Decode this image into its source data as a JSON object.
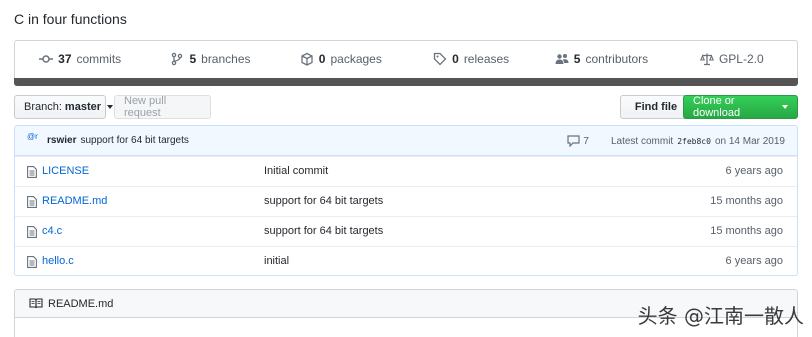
{
  "repo": {
    "description": "C in four functions"
  },
  "summary": {
    "items": [
      {
        "icon": "commits-icon",
        "count": "37",
        "label": "commits"
      },
      {
        "icon": "branch-icon",
        "count": "5",
        "label": "branches"
      },
      {
        "icon": "package-icon",
        "count": "0",
        "label": "packages"
      },
      {
        "icon": "tag-icon",
        "count": "0",
        "label": "releases"
      },
      {
        "icon": "people-icon",
        "count": "5",
        "label": "contributors"
      },
      {
        "icon": "law-icon",
        "count": "",
        "label": "GPL-2.0"
      }
    ],
    "language_bar_color": "#555555"
  },
  "toolbar": {
    "branch_label": "Branch:",
    "branch_value": "master",
    "new_pr_label": "New pull request",
    "find_file_label": "Find file",
    "clone_label": "Clone or download"
  },
  "latest_commit": {
    "avatar_alt": "@r",
    "author": "rswier",
    "message": "support for 64 bit targets",
    "comment_count": "7",
    "prefix": "Latest commit",
    "sha": "2feb8c0",
    "date_text": "on 14 Mar 2019"
  },
  "files": [
    {
      "name": "LICENSE",
      "message": "Initial commit",
      "age": "6 years ago"
    },
    {
      "name": "README.md",
      "message": "support for 64 bit targets",
      "age": "15 months ago"
    },
    {
      "name": "c4.c",
      "message": "support for 64 bit targets",
      "age": "15 months ago"
    },
    {
      "name": "hello.c",
      "message": "initial",
      "age": "6 years ago"
    }
  ],
  "readme": {
    "title": "README.md"
  },
  "watermark": "头条 @江南一散人",
  "colors": {
    "link": "#0366d6",
    "green": "#28a745",
    "commit_bg": "#f1f8ff"
  }
}
